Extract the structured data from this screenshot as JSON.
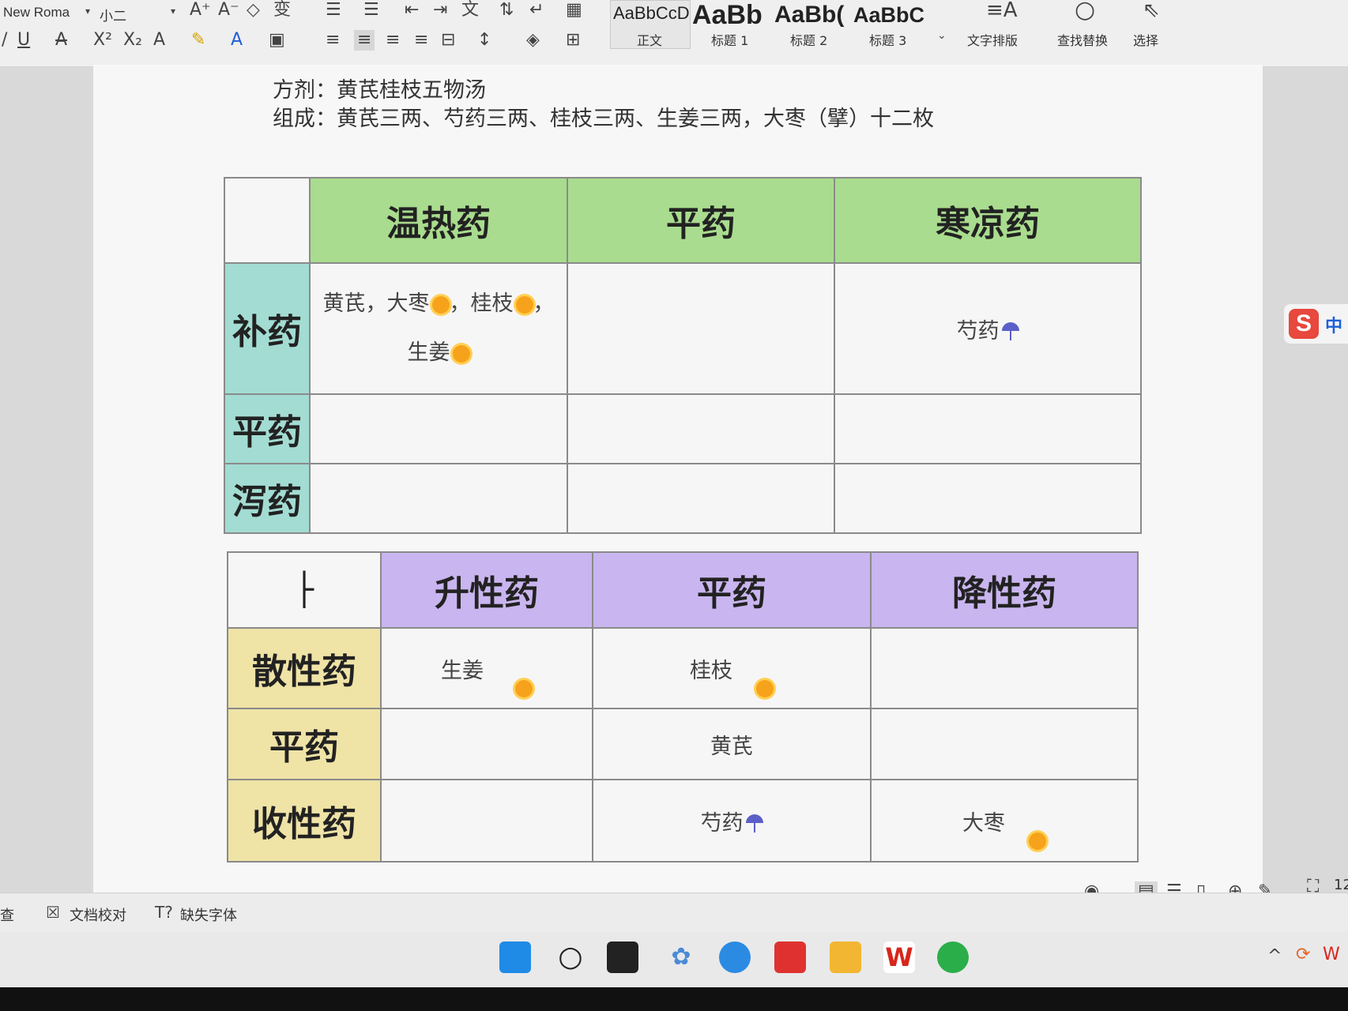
{
  "ribbon": {
    "font_name": "New Roma",
    "font_size": "小二",
    "style_previews": [
      "AaBbCcDd",
      "AaBb",
      "AaBb(",
      "AaBbC"
    ],
    "style_labels": [
      "正文",
      "标题 1",
      "标题 2",
      "标题 3"
    ],
    "text_layout": "文字排版",
    "find_replace": "查找替换",
    "select": "选择"
  },
  "document": {
    "line1": "方剂：黄芪桂枝五物汤",
    "line2": "组成：黄芪三两、芍药三两、桂枝三两、生姜三两，大枣（擘）十二枚"
  },
  "table1": {
    "col_headers": [
      "温热药",
      "平药",
      "寒凉药"
    ],
    "row_headers": [
      "补药",
      "平药",
      "泻药"
    ],
    "cells": {
      "r0c0_line1": "黄芪，大枣",
      "r0c0_mid": "，桂枝",
      "r0c0_end": "，",
      "r0c0_line2": "生姜",
      "r0c2": "芍药"
    }
  },
  "table2": {
    "corner": "├",
    "col_headers": [
      "升性药",
      "平药",
      "降性药"
    ],
    "row_headers": [
      "散性药",
      "平药",
      "收性药"
    ],
    "cells": {
      "r0c0": "生姜",
      "r0c1": "桂枝",
      "r1c1": "黄芪",
      "r2c1": "芍药",
      "r2c2": "大枣"
    }
  },
  "statusbar": {
    "left_item": "查",
    "proofread": "文档校对",
    "missing_fonts": "缺失字体",
    "zoom_partial": "12"
  },
  "ime": {
    "logo": "S",
    "mode": "中"
  },
  "icons": [
    "sun-icon",
    "umbrella-icon",
    "eye-icon",
    "page-view-icon",
    "outline-icon",
    "read-icon",
    "web-icon",
    "pen-icon",
    "fullscreen-icon"
  ],
  "colors": {
    "green_header": "#a9dc8e",
    "cyan_header": "#a3dcd3",
    "purple_header": "#c9b5ef",
    "yellow_header": "#efe3a6",
    "sun": "#f7a21b",
    "umbrella": "#5b5fc7"
  }
}
